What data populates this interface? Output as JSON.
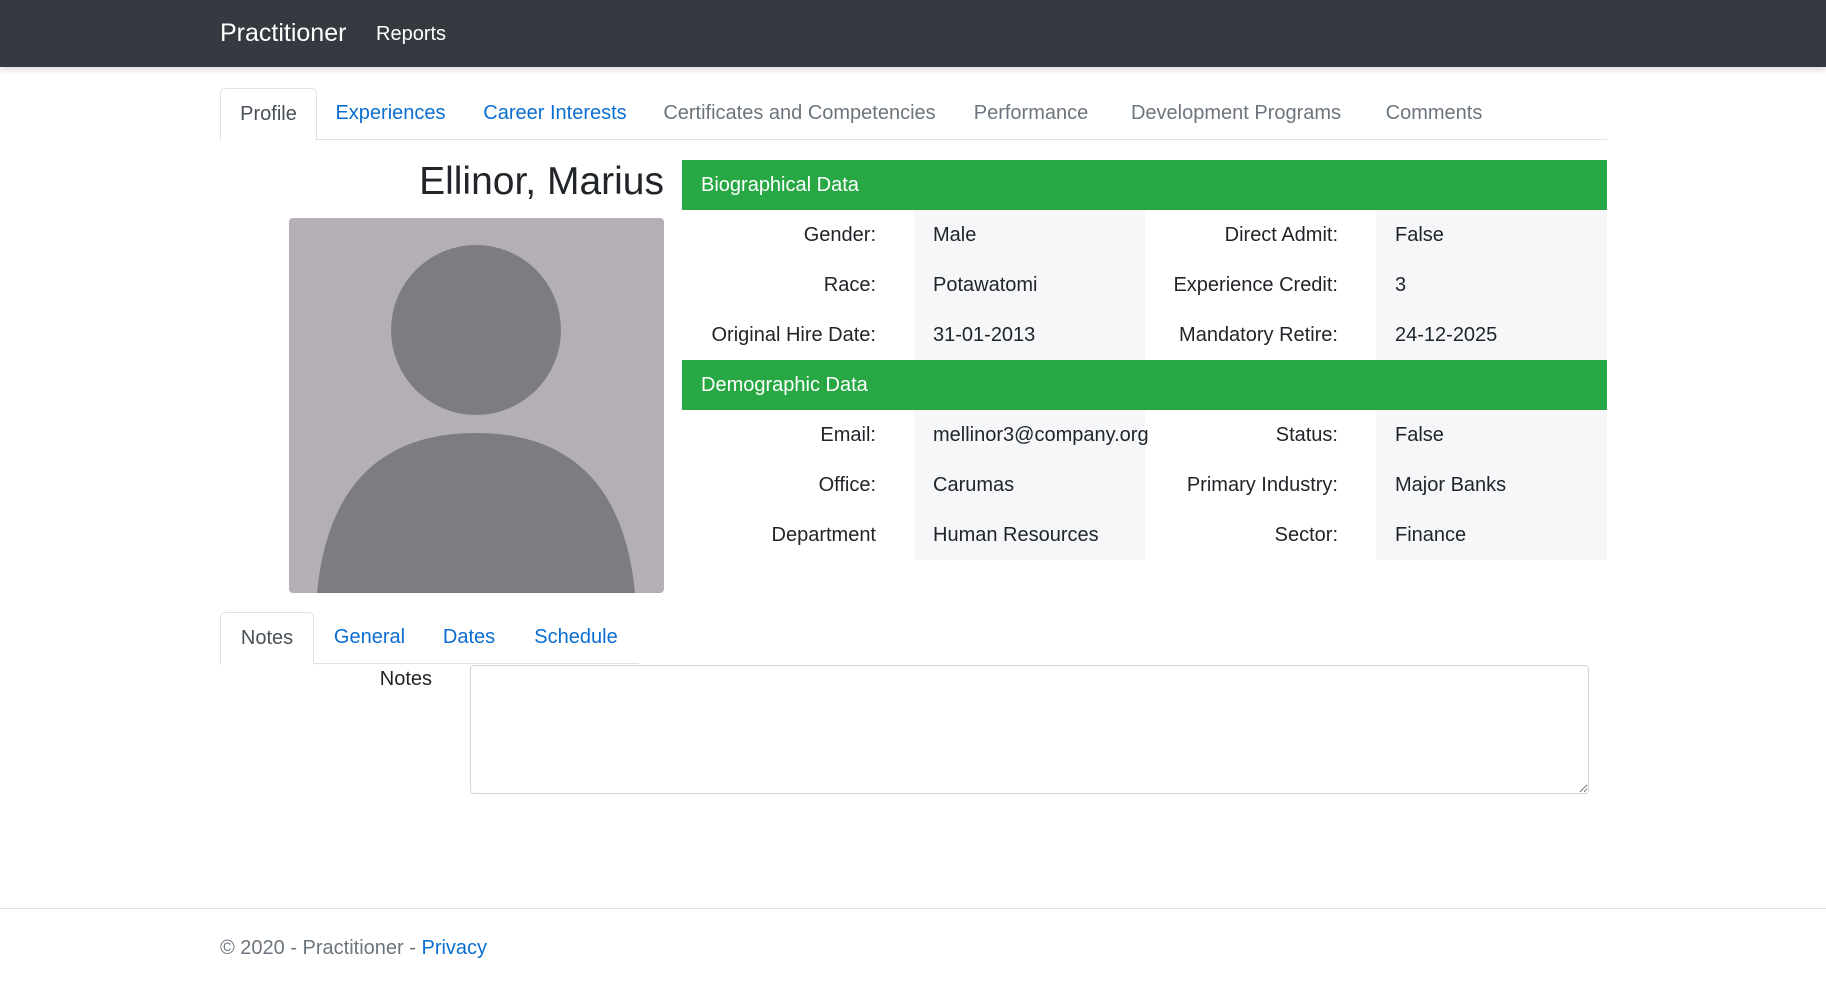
{
  "navbar": {
    "brand": "Practitioner",
    "links": [
      "Reports"
    ]
  },
  "main_tabs": [
    {
      "label": "Profile",
      "state": "active"
    },
    {
      "label": "Experiences",
      "state": "link"
    },
    {
      "label": "Career Interests",
      "state": "link"
    },
    {
      "label": "Certificates and Competencies",
      "state": "muted"
    },
    {
      "label": "Performance",
      "state": "muted"
    },
    {
      "label": "Development Programs",
      "state": "muted"
    },
    {
      "label": "Comments",
      "state": "muted"
    }
  ],
  "profile": {
    "name": "Ellinor, Marius",
    "avatar_icon": "user-silhouette-icon"
  },
  "biographical": {
    "title": "Biographical Data",
    "rows": [
      {
        "label1": "Gender:",
        "value1": "Male",
        "label2": "Direct Admit:",
        "value2": "False"
      },
      {
        "label1": "Race:",
        "value1": "Potawatomi",
        "label2": "Experience Credit:",
        "value2": "3"
      },
      {
        "label1": "Original Hire Date:",
        "value1": "31-01-2013",
        "label2": "Mandatory Retire:",
        "value2": "24-12-2025"
      }
    ]
  },
  "demographic": {
    "title": "Demographic Data",
    "rows": [
      {
        "label1": "Email:",
        "value1": "mellinor3@company.org",
        "label2": "Status:",
        "value2": "False"
      },
      {
        "label1": "Office:",
        "value1": "Carumas",
        "label2": "Primary Industry:",
        "value2": "Major Banks"
      },
      {
        "label1": "Department",
        "value1": "Human Resources",
        "label2": "Sector:",
        "value2": "Finance"
      }
    ]
  },
  "sub_tabs": [
    {
      "label": "Notes",
      "state": "active"
    },
    {
      "label": "General",
      "state": "link"
    },
    {
      "label": "Dates",
      "state": "link"
    },
    {
      "label": "Schedule",
      "state": "link"
    }
  ],
  "notes": {
    "label": "Notes",
    "value": ""
  },
  "footer": {
    "text": "© 2020 - Practitioner - ",
    "link": "Privacy"
  },
  "colors": {
    "navbar": "#343a40",
    "section_header": "#28a745",
    "link": "#0a6ed1",
    "muted": "#6c757d",
    "avatar_bg": "#b3afb4",
    "avatar_fg": "#7d7c81"
  }
}
